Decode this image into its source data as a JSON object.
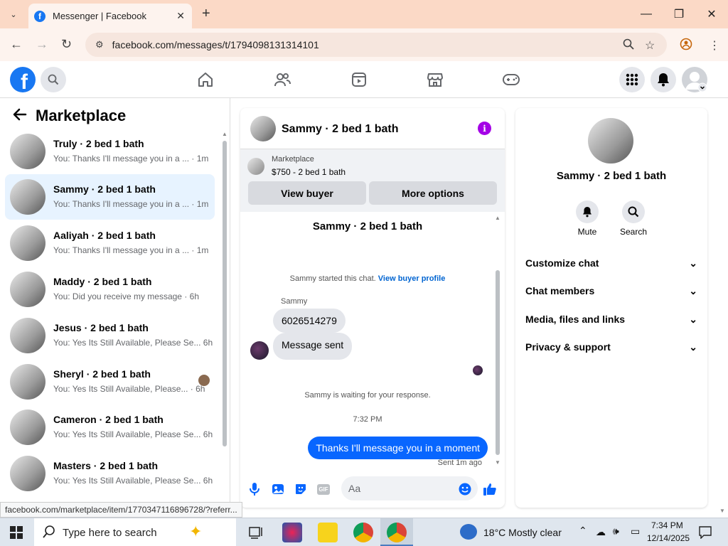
{
  "browser": {
    "tab_title": "Messenger | Facebook",
    "url": "facebook.com/messages/t/1794098131314101",
    "status_url": "facebook.com/marketplace/item/1770347116896728/?referr..."
  },
  "marketplace": {
    "title": "Marketplace",
    "conversations": [
      {
        "name": "Truly · 2 bed 1 bath",
        "preview": "You: Thanks I'll message you in a ... · 1m"
      },
      {
        "name": "Sammy · 2 bed 1 bath",
        "preview": "You: Thanks I'll message you in a ... · 1m"
      },
      {
        "name": "Aaliyah · 2 bed 1 bath",
        "preview": "You: Thanks I'll message you in a ... · 1m"
      },
      {
        "name": "Maddy · 2 bed 1 bath",
        "preview": "You: Did you receive my message · 6h"
      },
      {
        "name": "Jesus · 2 bed 1 bath",
        "preview": "You: Yes Its Still Available, Please Se... 6h"
      },
      {
        "name": "Sheryl · 2 bed 1 bath",
        "preview": "You: Yes Its Still Available, Please... · 6h"
      },
      {
        "name": "Cameron · 2 bed 1 bath",
        "preview": "You: Yes Its Still Available, Please Se... 6h"
      },
      {
        "name": "Masters · 2 bed 1 bath",
        "preview": "You: Yes Its Still Available, Please Se... 6h"
      }
    ]
  },
  "chat": {
    "title": "Sammy · 2 bed 1 bath",
    "listing_label": "Marketplace",
    "listing_price": "$750 - 2 bed 1 bath",
    "view_buyer": "View buyer",
    "more_options": "More options",
    "intro_name": "Sammy · 2 bed 1 bath",
    "started_text": "Sammy started this chat.",
    "buyer_profile_link": "View buyer profile",
    "sender": "Sammy",
    "msg1": "6026514279",
    "msg2": "Message sent",
    "waiting": "Sammy is waiting for your response.",
    "time": "7:32 PM",
    "my_msg": "Thanks I'll message you in a moment",
    "sent_status": "Sent 1m ago",
    "composer_placeholder": "Aa"
  },
  "details": {
    "name": "Sammy · 2 bed 1 bath",
    "mute": "Mute",
    "search": "Search",
    "sections": [
      "Customize chat",
      "Chat members",
      "Media, files and links",
      "Privacy & support"
    ]
  },
  "taskbar": {
    "search_placeholder": "Type here to search",
    "weather": "18°C  Mostly clear",
    "time": "7:34 PM",
    "date": "12/14/2025"
  }
}
